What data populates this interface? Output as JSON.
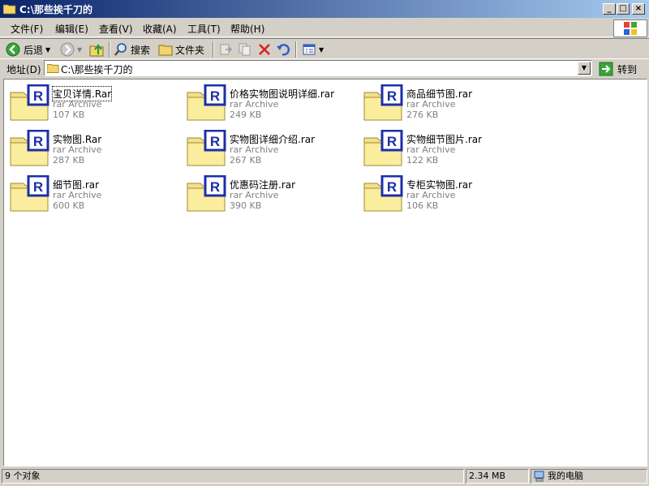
{
  "window": {
    "title": "C:\\那些挨千刀的",
    "minimize": "_",
    "maximize": "□",
    "close": "×"
  },
  "menu": {
    "items": [
      {
        "label": "文件(F)"
      },
      {
        "label": "编辑(E)"
      },
      {
        "label": "查看(V)"
      },
      {
        "label": "收藏(A)"
      },
      {
        "label": "工具(T)"
      },
      {
        "label": "帮助(H)"
      }
    ]
  },
  "toolbar": {
    "back_label": "后退",
    "search_label": "搜索",
    "folders_label": "文件夹"
  },
  "address": {
    "label": "地址(D)",
    "path": "C:\\那些挨千刀的",
    "go_label": "转到"
  },
  "files": [
    {
      "name": "宝贝详情.Rar",
      "type": "rar Archive",
      "size": "107 KB"
    },
    {
      "name": "价格实物图说明详细.rar",
      "type": "rar Archive",
      "size": "249 KB"
    },
    {
      "name": "商品细节图.rar",
      "type": "rar Archive",
      "size": "276 KB"
    },
    {
      "name": "实物图.Rar",
      "type": "rar Archive",
      "size": "287 KB"
    },
    {
      "name": "实物图详细介绍.rar",
      "type": "rar Archive",
      "size": "267 KB"
    },
    {
      "name": "实物细节图片.rar",
      "type": "rar Archive",
      "size": "122 KB"
    },
    {
      "name": "细节图.rar",
      "type": "rar Archive",
      "size": "600 KB"
    },
    {
      "name": "优惠码注册.rar",
      "type": "rar Archive",
      "size": "390 KB"
    },
    {
      "name": "专柜实物图.rar",
      "type": "rar Archive",
      "size": "106 KB"
    }
  ],
  "status": {
    "count": "9 个对象",
    "size": "2.34 MB",
    "location": "我的电脑"
  },
  "icons": {
    "file": "rar-archive-icon",
    "folder": "folder-icon"
  },
  "colors": {
    "titlebar_start": "#0a246a",
    "titlebar_end": "#a6caf0",
    "chrome": "#d4d0c8",
    "rar_blue": "#1c2fa8"
  }
}
